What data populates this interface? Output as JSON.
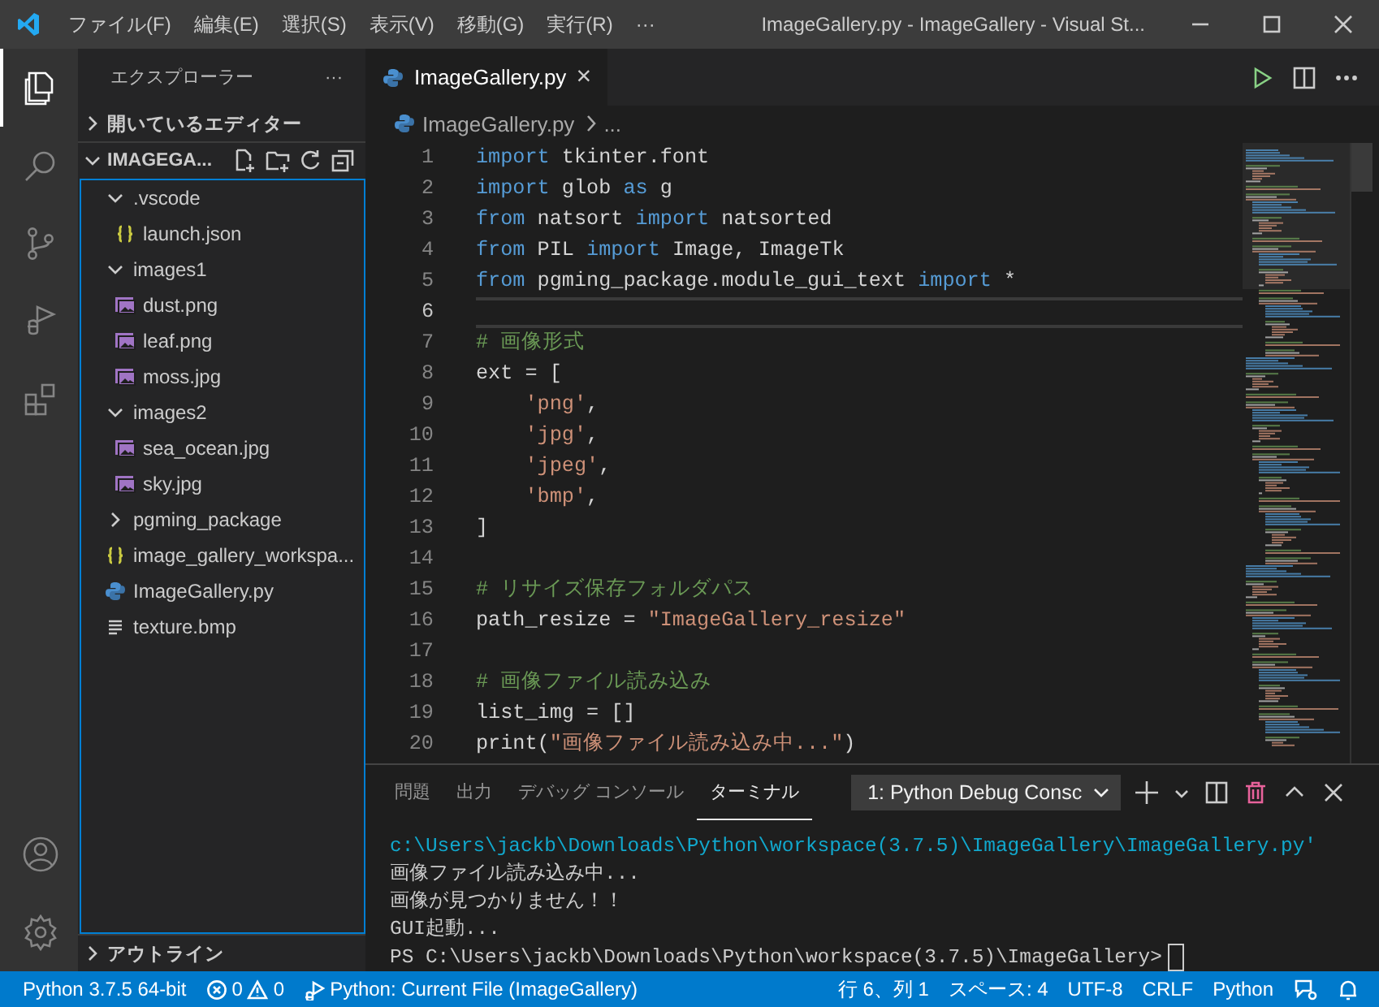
{
  "titlebar": {
    "menus": [
      "ファイル(F)",
      "編集(E)",
      "選択(S)",
      "表示(V)",
      "移動(G)",
      "実行(R)"
    ],
    "more": "···",
    "title": "ImageGallery.py - ImageGallery - Visual St..."
  },
  "activity": {
    "items": [
      {
        "kind": "explorer",
        "selected": true
      },
      {
        "kind": "search",
        "selected": false
      },
      {
        "kind": "scm",
        "selected": false
      },
      {
        "kind": "debug",
        "selected": false
      },
      {
        "kind": "extensions",
        "selected": false
      }
    ],
    "bottom": [
      {
        "kind": "account"
      },
      {
        "kind": "settings"
      }
    ]
  },
  "sidebar": {
    "title": "エクスプローラー",
    "more": "···",
    "sections": [
      {
        "title": "開いているエディター",
        "expanded": false
      },
      {
        "title": "IMAGEGA...",
        "expanded": true,
        "tree": [
          {
            "label": ".vscode",
            "kind": "folder",
            "expanded": true,
            "children": [
              {
                "label": "launch.json",
                "kind": "json"
              }
            ]
          },
          {
            "label": "images1",
            "kind": "folder",
            "expanded": true,
            "children": [
              {
                "label": "dust.png",
                "kind": "image"
              },
              {
                "label": "leaf.png",
                "kind": "image"
              },
              {
                "label": "moss.jpg",
                "kind": "image"
              }
            ]
          },
          {
            "label": "images2",
            "kind": "folder",
            "expanded": true,
            "children": [
              {
                "label": "sea_ocean.jpg",
                "kind": "image"
              },
              {
                "label": "sky.jpg",
                "kind": "image"
              }
            ]
          },
          {
            "label": "pgming_package",
            "kind": "folder",
            "expanded": false
          },
          {
            "label": "image_gallery_workspa...",
            "kind": "json"
          },
          {
            "label": "ImageGallery.py",
            "kind": "python"
          },
          {
            "label": "texture.bmp",
            "kind": "text"
          }
        ]
      },
      {
        "title": "アウトライン",
        "expanded": false
      }
    ]
  },
  "editor": {
    "tabs": [
      {
        "label": "ImageGallery.py",
        "selected": true,
        "close": "×"
      }
    ],
    "breadcrumb": {
      "file": "ImageGallery.py",
      "rest": "..."
    },
    "lines": [
      {
        "number": "1",
        "current": false,
        "tokens": [
          {
            "t": "import",
            "kind": "keyword"
          },
          {
            "t": " tkinter.font",
            "kind": "text"
          }
        ]
      },
      {
        "number": "2",
        "current": false,
        "tokens": [
          {
            "t": "import",
            "kind": "keyword"
          },
          {
            "t": " glob ",
            "kind": "text"
          },
          {
            "t": "as",
            "kind": "keyword"
          },
          {
            "t": " g",
            "kind": "text"
          }
        ]
      },
      {
        "number": "3",
        "current": false,
        "tokens": [
          {
            "t": "from",
            "kind": "keyword"
          },
          {
            "t": " natsort ",
            "kind": "text"
          },
          {
            "t": "import",
            "kind": "keyword"
          },
          {
            "t": " natsorted",
            "kind": "text"
          }
        ]
      },
      {
        "number": "4",
        "current": false,
        "tokens": [
          {
            "t": "from",
            "kind": "keyword"
          },
          {
            "t": " PIL ",
            "kind": "text"
          },
          {
            "t": "import",
            "kind": "keyword"
          },
          {
            "t": " Image, ImageTk",
            "kind": "text"
          }
        ]
      },
      {
        "number": "5",
        "current": false,
        "tokens": [
          {
            "t": "from",
            "kind": "keyword"
          },
          {
            "t": " pgming_package.module_gui_text ",
            "kind": "text"
          },
          {
            "t": "import",
            "kind": "keyword"
          },
          {
            "t": " *",
            "kind": "text"
          }
        ]
      },
      {
        "number": "6",
        "current": true
      },
      {
        "number": "7",
        "current": false,
        "tokens": [
          {
            "t": "# 画像形式",
            "kind": "comment"
          }
        ]
      },
      {
        "number": "8",
        "current": false,
        "tokens": [
          {
            "t": "ext = [",
            "kind": "text"
          }
        ]
      },
      {
        "number": "9",
        "current": false,
        "tokens": [
          {
            "t": "    'png'",
            "kind": "string"
          },
          {
            "t": ",",
            "kind": "text"
          }
        ]
      },
      {
        "number": "10",
        "current": false,
        "tokens": [
          {
            "t": "    'jpg'",
            "kind": "string"
          },
          {
            "t": ",",
            "kind": "text"
          }
        ]
      },
      {
        "number": "11",
        "current": false,
        "tokens": [
          {
            "t": "    'jpeg'",
            "kind": "string"
          },
          {
            "t": ",",
            "kind": "text"
          }
        ]
      },
      {
        "number": "12",
        "current": false,
        "tokens": [
          {
            "t": "    'bmp'",
            "kind": "string"
          },
          {
            "t": ",",
            "kind": "text"
          }
        ]
      },
      {
        "number": "13",
        "current": false,
        "tokens": [
          {
            "t": "]",
            "kind": "text"
          }
        ]
      },
      {
        "number": "14",
        "current": false
      },
      {
        "number": "15",
        "current": false,
        "tokens": [
          {
            "t": "# リサイズ保存フォルダパス",
            "kind": "comment"
          }
        ]
      },
      {
        "number": "16",
        "current": false,
        "tokens": [
          {
            "t": "path_resize = ",
            "kind": "text"
          },
          {
            "t": "\"ImageGallery_resize\"",
            "kind": "string"
          }
        ]
      },
      {
        "number": "17",
        "current": false
      },
      {
        "number": "18",
        "current": false,
        "tokens": [
          {
            "t": "# 画像ファイル読み込み",
            "kind": "comment"
          }
        ]
      },
      {
        "number": "19",
        "current": false,
        "tokens": [
          {
            "t": "list_img = []",
            "kind": "text"
          }
        ]
      },
      {
        "number": "20",
        "current": false,
        "tokens": [
          {
            "t": "print(",
            "kind": "text"
          },
          {
            "t": "\"画像ファイル読み込み中...\"",
            "kind": "string"
          },
          {
            "t": ")",
            "kind": "text"
          }
        ]
      }
    ]
  },
  "panel": {
    "tabs": [
      {
        "label": "問題",
        "selected": false
      },
      {
        "label": "出力",
        "selected": false
      },
      {
        "label": "デバッグ コンソール",
        "selected": false
      },
      {
        "label": "ターミナル",
        "selected": true
      }
    ],
    "terminal_select": "1: Python Debug Consc",
    "terminal": [
      {
        "kind": "path",
        "text": "c:\\Users\\jackb\\Downloads\\Python\\workspace(3.7.5)\\ImageGallery\\ImageGallery.py'"
      },
      {
        "kind": "output",
        "text": "画像ファイル読み込み中..."
      },
      {
        "kind": "output",
        "text": "画像が見つかりません！！"
      },
      {
        "kind": "output",
        "text": "GUI起動..."
      },
      {
        "kind": "prompt",
        "text": "PS C:\\Users\\jackb\\Downloads\\Python\\workspace(3.7.5)\\ImageGallery>"
      }
    ]
  },
  "status_bar": {
    "interpreter": "Python 3.7.5 64-bit",
    "errors": "0",
    "warnings": "0",
    "launch": "Python: Current File (ImageGallery)",
    "position": "行 6、列 1",
    "indent": "スペース: 4",
    "encoding": "UTF-8",
    "eol": "CRLF",
    "language": "Python"
  }
}
